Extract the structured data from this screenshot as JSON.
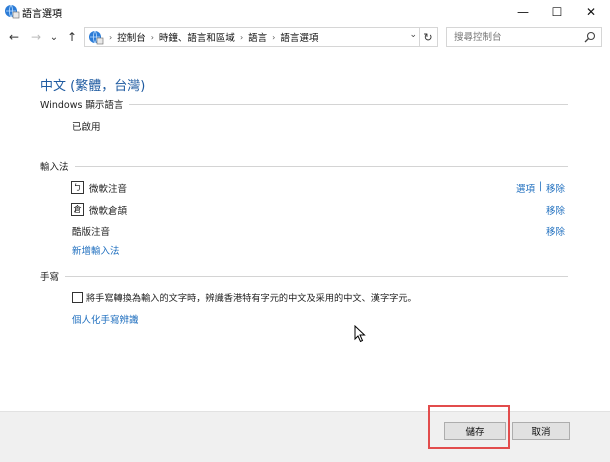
{
  "window": {
    "title": "語言選項",
    "controls": {
      "minimize": "—",
      "maximize": "☐",
      "close": "✕"
    }
  },
  "nav": {
    "back": "←",
    "forward": "→",
    "recent": "⌄",
    "up": "↑",
    "breadcrumbs": [
      "控制台",
      "時鐘、語言和區域",
      "語言",
      "語言選項"
    ],
    "dropdown": "⌄",
    "refresh": "↻",
    "search_placeholder": "搜尋控制台"
  },
  "main": {
    "heading": "中文 (繁體，台灣)",
    "display_section": {
      "label": "Windows 顯示語言",
      "value": "已啟用"
    },
    "input_section": {
      "label": "輸入法",
      "methods": [
        {
          "icon": "ㄅ",
          "name": "微軟注音",
          "options_link": "選項",
          "separator": "|",
          "remove_link": "移除"
        },
        {
          "icon": "倉",
          "name": "微軟倉頡",
          "remove_link": "移除"
        },
        {
          "name": "酷版注音",
          "remove_link": "移除"
        }
      ],
      "add_link": "新增輸入法"
    },
    "handwriting_section": {
      "label": "手寫",
      "checkbox_label": "將手寫轉換為輸入的文字時，辨識香港特有字元的中文及采用的中文、漢字字元。",
      "checkbox_checked": false,
      "personalize_link": "個人化手寫辨識"
    }
  },
  "footer": {
    "save_label": "儲存",
    "cancel_label": "取消"
  },
  "colors": {
    "link": "#1f6fbf",
    "heading": "#1e5aa0",
    "highlight": "#e24c4c"
  }
}
